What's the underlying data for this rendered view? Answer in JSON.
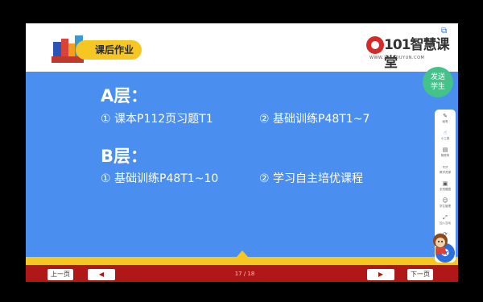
{
  "header": {
    "title": "课后作业",
    "logo_text": "101智慧课堂",
    "logo_url": "WWW.101EDUYUN.COM"
  },
  "content": {
    "level_a": {
      "heading": "A层：",
      "item1": "①  课本P112页习题T1",
      "item2": "②  基础训练P48T1~7"
    },
    "level_b": {
      "heading": "B层：",
      "item1": "①  基础训练P48T1~10",
      "item2": "②  学习自主培优课程"
    }
  },
  "send_button": {
    "line1": "发送",
    "line2": "学生"
  },
  "toolbar": {
    "items": [
      {
        "icon": "pen-icon",
        "glyph": "✎",
        "label": "画笔"
      },
      {
        "icon": "pointer-icon",
        "glyph": "☝",
        "label": "小工具"
      },
      {
        "icon": "whiteboard-icon",
        "glyph": "▤",
        "label": "随堂练"
      },
      {
        "icon": "screen-icon",
        "glyph": "▭",
        "label": "教学资源"
      },
      {
        "icon": "screenshot-icon",
        "glyph": "▣",
        "label": "全班截图"
      },
      {
        "icon": "people-icon",
        "glyph": "☺",
        "label": "学生管理"
      },
      {
        "icon": "expand-icon",
        "glyph": "⤢",
        "label": "加入互动"
      },
      {
        "icon": "sync-icon",
        "glyph": "⟳",
        "label": "同步"
      }
    ]
  },
  "footer": {
    "prev_label": "上一页",
    "next_label": "下一页",
    "page_indicator": "17 / 18"
  }
}
